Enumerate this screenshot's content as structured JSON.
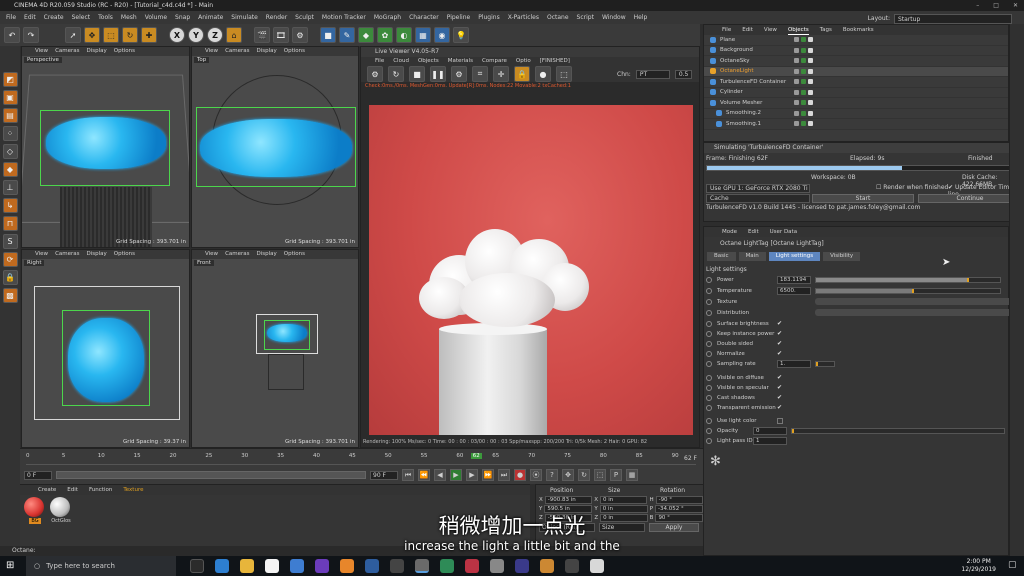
{
  "window": {
    "title": "CINEMA 4D R20.059 Studio (RC - R20) - [Tutorial_c4d.c4d *] - Main",
    "layout_label": "Layout:",
    "layout_value": "Startup"
  },
  "menu": [
    "File",
    "Edit",
    "Create",
    "Select",
    "Tools",
    "Mesh",
    "Volume",
    "Snap",
    "Animate",
    "Simulate",
    "Render",
    "Sculpt",
    "Motion Tracker",
    "MoGraph",
    "Character",
    "Pipeline",
    "Plugins",
    "X-Particles",
    "Octane",
    "Script",
    "Window",
    "Help"
  ],
  "viewports": {
    "menu": [
      "View",
      "Cameras",
      "Display",
      "Options"
    ],
    "perspective": {
      "name": "Perspective",
      "grid": ""
    },
    "top": {
      "name": "Top",
      "grid": "Grid Spacing : 393.701 in"
    },
    "right": {
      "name": "Right",
      "grid": "Grid Spacing : 39.37 in"
    },
    "front": {
      "name": "Front",
      "grid": "Grid Spacing : 393.701 in"
    },
    "persp_grid": "Grid Spacing : 393.701 in"
  },
  "live_viewer": {
    "title": "Live Viewer V4.05-R7",
    "menu": [
      "File",
      "Cloud",
      "Objects",
      "Materials",
      "Compare",
      "Optio",
      "[FINISHED]"
    ],
    "channel_label": "Chn:",
    "channel_value": "PT",
    "zoom_value": "0.5",
    "status": "Check:0ms./0ms. MeshGen:0ms. Update[R]:0ms. Nodes:22 Movable:2 txCached:1",
    "footer": "Rendering: 100% Ms/sec: 0    Time: 00 : 00 : 03/00 : 00 : 03  Spp/maxspp: 200/200    Tri: 0/5k  Mesh: 2  Hair: 0    GPU:   82"
  },
  "object_manager": {
    "tabs": [
      "File",
      "Edit",
      "View",
      "Objects",
      "Tags",
      "Bookmarks"
    ],
    "active_tab": "Objects",
    "objects": [
      {
        "name": "Plane",
        "color": "#4a90d9"
      },
      {
        "name": "Background",
        "color": "#4a90d9"
      },
      {
        "name": "OctaneSky",
        "color": "#4a90d9"
      },
      {
        "name": "OctaneLight",
        "color": "#e8a22a"
      },
      {
        "name": "TurbulenceFD Container",
        "color": "#4a90d9"
      },
      {
        "name": "Cylinder",
        "color": "#4a90d9"
      },
      {
        "name": "Volume Mesher",
        "color": "#4a90d9"
      },
      {
        "name": "Smoothing.2",
        "color": "#4a90d9"
      },
      {
        "name": "Smoothing.1",
        "color": "#4a90d9"
      }
    ]
  },
  "simulation": {
    "heading": "Simulating 'TurbulenceFD Container'",
    "frame": "Frame: Finishing 62F",
    "elapsed": "Elapsed: 9s",
    "finished": "Finished",
    "progress": 0.62,
    "workspace": "Workspace: 0B",
    "disk_cache": "Disk Cache: 422.66MB",
    "gpu": "Use GPU 1: GeForce RTX 2080 Ti",
    "render_when_finished": "Render when finished",
    "update_editor": "Update Editor Time-line",
    "cache": "Cache",
    "start": "Start",
    "continue": "Continue",
    "license": "TurbulenceFD v1.0 Build 1445 - licensed to pat.james.foley@gmail.com"
  },
  "attributes": {
    "menu": [
      "Mode",
      "Edit",
      "User Data"
    ],
    "tag_title": "Octane LightTag [Octane LightTag]",
    "tabs": [
      "Basic",
      "Main",
      "Light settings",
      "Visibility"
    ],
    "active_tab": "Light settings",
    "section": "Light settings",
    "power_label": "Power",
    "power_value": "183.1194",
    "power_fill": 0.83,
    "temperature_label": "Temperature",
    "temperature_value": "6500.",
    "temperature_fill": 0.53,
    "texture_label": "Texture",
    "distribution_label": "Distribution",
    "surface_brightness": "Surface brightness",
    "keep_instance_power": "Keep instance power",
    "double_sided": "Double sided",
    "normalize": "Normalize",
    "sampling_rate_label": "Sampling rate",
    "sampling_rate_value": "1.",
    "visible_on_diffuse": "Visible on diffuse",
    "visible_on_specular": "Visible on specular",
    "cast_shadows": "Cast shadows",
    "transparent_emission": "Transparent emission",
    "use_light_color": "Use light color",
    "opacity_label": "Opacity",
    "opacity_value": "0",
    "light_pass_label": "Light pass ID",
    "light_pass_value": "1"
  },
  "timeline": {
    "ticks": [
      "0",
      "5",
      "10",
      "15",
      "20",
      "25",
      "30",
      "35",
      "40",
      "45",
      "50",
      "55",
      "60",
      "62",
      "65",
      "70",
      "75",
      "80",
      "85",
      "90"
    ],
    "start": "0 F",
    "end": "90 F",
    "current": "62 F",
    "field_a": "0 F",
    "field_b": "90 F"
  },
  "material_manager": {
    "menu": [
      "Create",
      "Edit",
      "Function",
      "Texture"
    ],
    "materials": [
      {
        "name": "BG",
        "color": "#d8332f"
      },
      {
        "name": "OctGlos",
        "color": "#bdbdbd"
      }
    ]
  },
  "coordinates": {
    "headers": [
      "Position",
      "Size",
      "Rotation"
    ],
    "rows": [
      {
        "p": "X",
        "pv": "-900.83 in",
        "s": "X",
        "sv": "0 in",
        "r": "H",
        "rv": "-90 °"
      },
      {
        "p": "Y",
        "pv": "590.5 in",
        "s": "Y",
        "sv": "0 in",
        "r": "P",
        "rv": "-34.052 °"
      },
      {
        "p": "Z",
        "pv": "-590.36 in",
        "s": "Z",
        "sv": "0 in",
        "r": "B",
        "rv": "90 °"
      }
    ],
    "object": "Object (Rel)",
    "size": "Size",
    "apply": "Apply"
  },
  "status_text": "Octane:",
  "subtitles": {
    "zh": "稍微增加一点光",
    "en": "increase the light a little bit and the"
  },
  "taskbar": {
    "search": "Type here to search",
    "time": "2:00 PM",
    "date": "12/29/2019"
  }
}
